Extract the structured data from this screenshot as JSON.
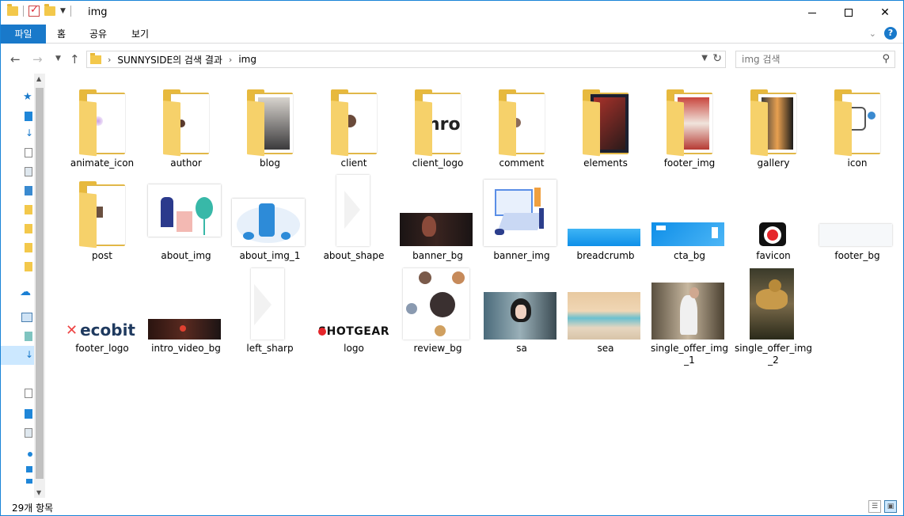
{
  "window": {
    "title": "img"
  },
  "ribbon": {
    "tabs": [
      "파일",
      "홈",
      "공유",
      "보기"
    ]
  },
  "address": {
    "crumbs": [
      "SUNNYSIDE의 검색 결과",
      "img"
    ]
  },
  "search": {
    "placeholder": "img 검색"
  },
  "status": {
    "count": "29개 항목"
  },
  "items": [
    {
      "name": "animate_icon",
      "kind": "folder"
    },
    {
      "name": "author",
      "kind": "folder"
    },
    {
      "name": "blog",
      "kind": "folder"
    },
    {
      "name": "client",
      "kind": "folder"
    },
    {
      "name": "client_logo",
      "kind": "folder"
    },
    {
      "name": "comment",
      "kind": "folder"
    },
    {
      "name": "elements",
      "kind": "folder"
    },
    {
      "name": "footer_img",
      "kind": "folder"
    },
    {
      "name": "gallery",
      "kind": "folder"
    },
    {
      "name": "icon",
      "kind": "folder"
    },
    {
      "name": "post",
      "kind": "folder"
    },
    {
      "name": "about_img",
      "kind": "image"
    },
    {
      "name": "about_img_1",
      "kind": "image"
    },
    {
      "name": "about_shape",
      "kind": "image"
    },
    {
      "name": "banner_bg",
      "kind": "image"
    },
    {
      "name": "banner_img",
      "kind": "image"
    },
    {
      "name": "breadcrumb",
      "kind": "image"
    },
    {
      "name": "cta_bg",
      "kind": "image"
    },
    {
      "name": "favicon",
      "kind": "image"
    },
    {
      "name": "footer_bg",
      "kind": "image"
    },
    {
      "name": "footer_logo",
      "kind": "image",
      "text": "ecobit"
    },
    {
      "name": "intro_video_bg",
      "kind": "image"
    },
    {
      "name": "left_sharp",
      "kind": "image"
    },
    {
      "name": "logo",
      "kind": "image",
      "text": "SHOTGEAR"
    },
    {
      "name": "review_bg",
      "kind": "image"
    },
    {
      "name": "sa",
      "kind": "image"
    },
    {
      "name": "sea",
      "kind": "image"
    },
    {
      "name": "single_offer_img_1",
      "kind": "image"
    },
    {
      "name": "single_offer_img_2",
      "kind": "image"
    }
  ],
  "colors": {
    "accent": "#1979ca",
    "folder": "#e7b93d",
    "folder_front": "#f6d16a"
  }
}
